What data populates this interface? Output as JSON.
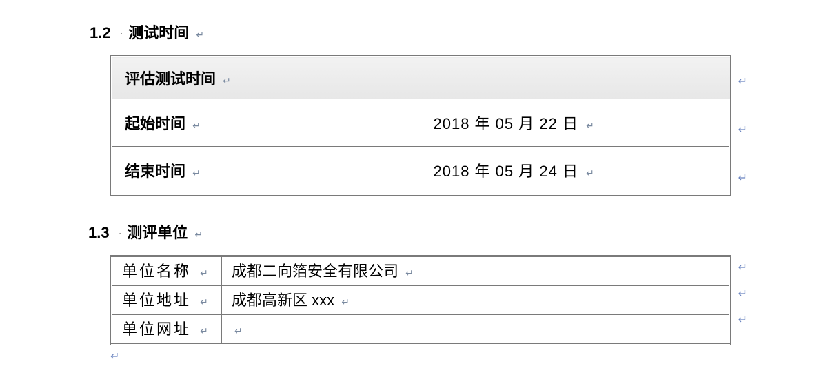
{
  "section1": {
    "number": "1.2",
    "title": "测试时间",
    "table": {
      "header": "评估测试时间",
      "rows": [
        {
          "label": "起始时间",
          "value": "2018 年 05 月 22 日"
        },
        {
          "label": "结束时间",
          "value": "2018 年 05 月 24 日"
        }
      ]
    }
  },
  "section2": {
    "number": "1.3",
    "title": "测评单位",
    "table": {
      "rows": [
        {
          "label": "单位名称",
          "value": "成都二向箔安全有限公司"
        },
        {
          "label": "单位地址",
          "value": "成都高新区 xxx"
        },
        {
          "label": "单位网址",
          "value": ""
        }
      ]
    }
  },
  "marks": {
    "para": "↵",
    "enter": "↵"
  }
}
